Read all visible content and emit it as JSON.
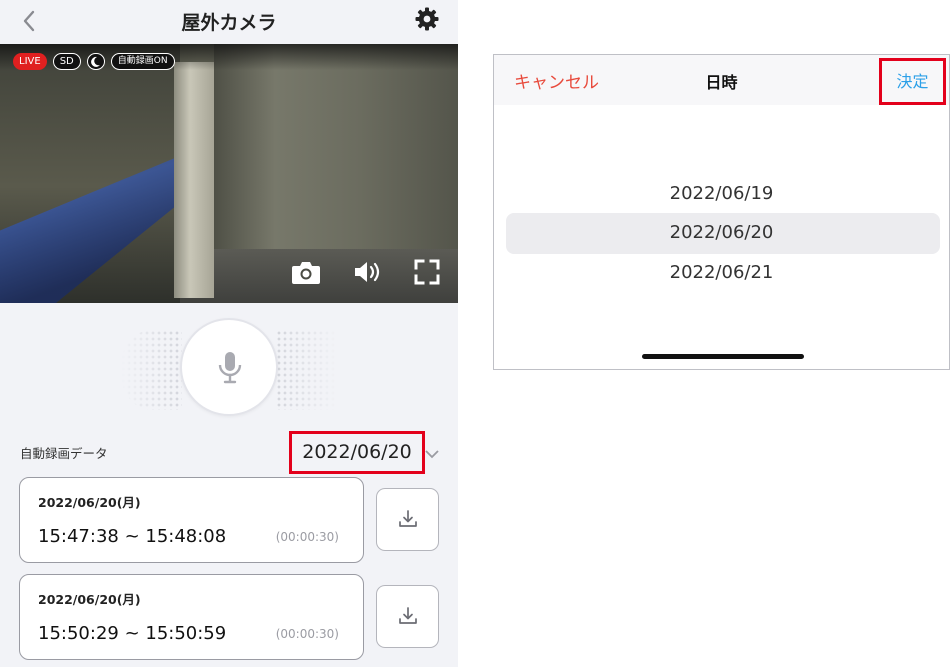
{
  "camera_screen": {
    "title": "屋外カメラ",
    "badges": {
      "live": "LIVE",
      "quality": "SD",
      "recording": "自動録画ON"
    },
    "section_label": "自動録画データ",
    "selected_date": "2022/06/20",
    "recordings": [
      {
        "date": "2022/06/20(月)",
        "time_range": "15:47:38 ~ 15:48:08",
        "duration": "(00:00:30)"
      },
      {
        "date": "2022/06/20(月)",
        "time_range": "15:50:29 ~ 15:50:59",
        "duration": "(00:00:30)"
      }
    ],
    "icons": [
      "back-chevron-icon",
      "gear-icon",
      "night-mode-icon",
      "camera-icon",
      "volume-icon",
      "fullscreen-icon",
      "microphone-icon",
      "chevron-down-icon",
      "download-icon"
    ]
  },
  "date_picker": {
    "cancel_label": "キャンセル",
    "title": "日時",
    "confirm_label": "決定",
    "options": [
      "2022/06/19",
      "2022/06/20",
      "2022/06/21"
    ],
    "selected": "2022/06/20"
  },
  "colors": {
    "highlight_box": "#e3001b",
    "cancel_text": "#e84a3c",
    "confirm_text": "#2ca0e8",
    "live_badge": "#e02020",
    "app_background": "#f2f3f7"
  }
}
